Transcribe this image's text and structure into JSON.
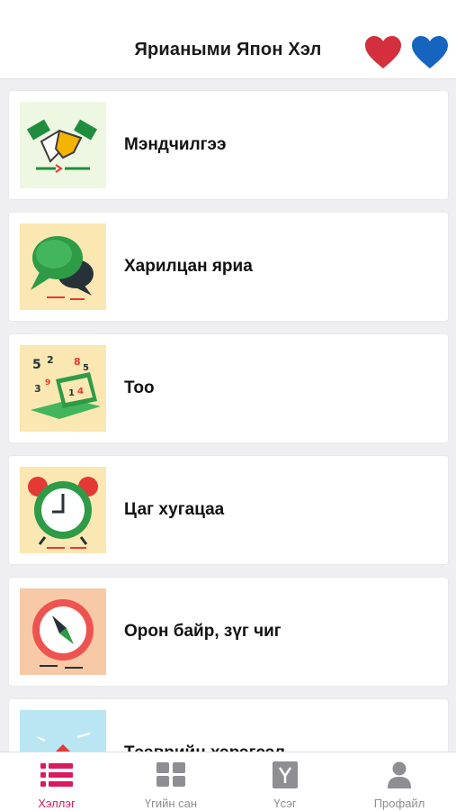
{
  "header": {
    "title": "Яриаными Япон Хэл",
    "favorite_red_icon": "heart-icon",
    "favorite_blue_icon": "heart-icon"
  },
  "categories": [
    {
      "label": "Мэндчилгээ",
      "icon": "handshake-icon"
    },
    {
      "label": "Харилцан яриа",
      "icon": "chat-bubbles-icon"
    },
    {
      "label": "Тоо",
      "icon": "numbers-laptop-icon"
    },
    {
      "label": "Цаг хугацаа",
      "icon": "alarm-clock-icon"
    },
    {
      "label": "Орон байр, зүг чиг",
      "icon": "compass-icon"
    },
    {
      "label": "Тээврийн хэрэгсэл",
      "icon": "transport-icon"
    }
  ],
  "tabs": [
    {
      "label": "Хэллэг",
      "icon": "list-icon",
      "active": true
    },
    {
      "label": "Үгийн сан",
      "icon": "grid-icon",
      "active": false
    },
    {
      "label": "Үсэг",
      "icon": "letter-y-icon",
      "active": false
    },
    {
      "label": "Профайл",
      "icon": "user-icon",
      "active": false
    }
  ],
  "colors": {
    "accent": "#d81b60",
    "heart_red": "#d32f3c",
    "heart_blue": "#1565c0",
    "inactive_tab": "#8e8e93"
  }
}
